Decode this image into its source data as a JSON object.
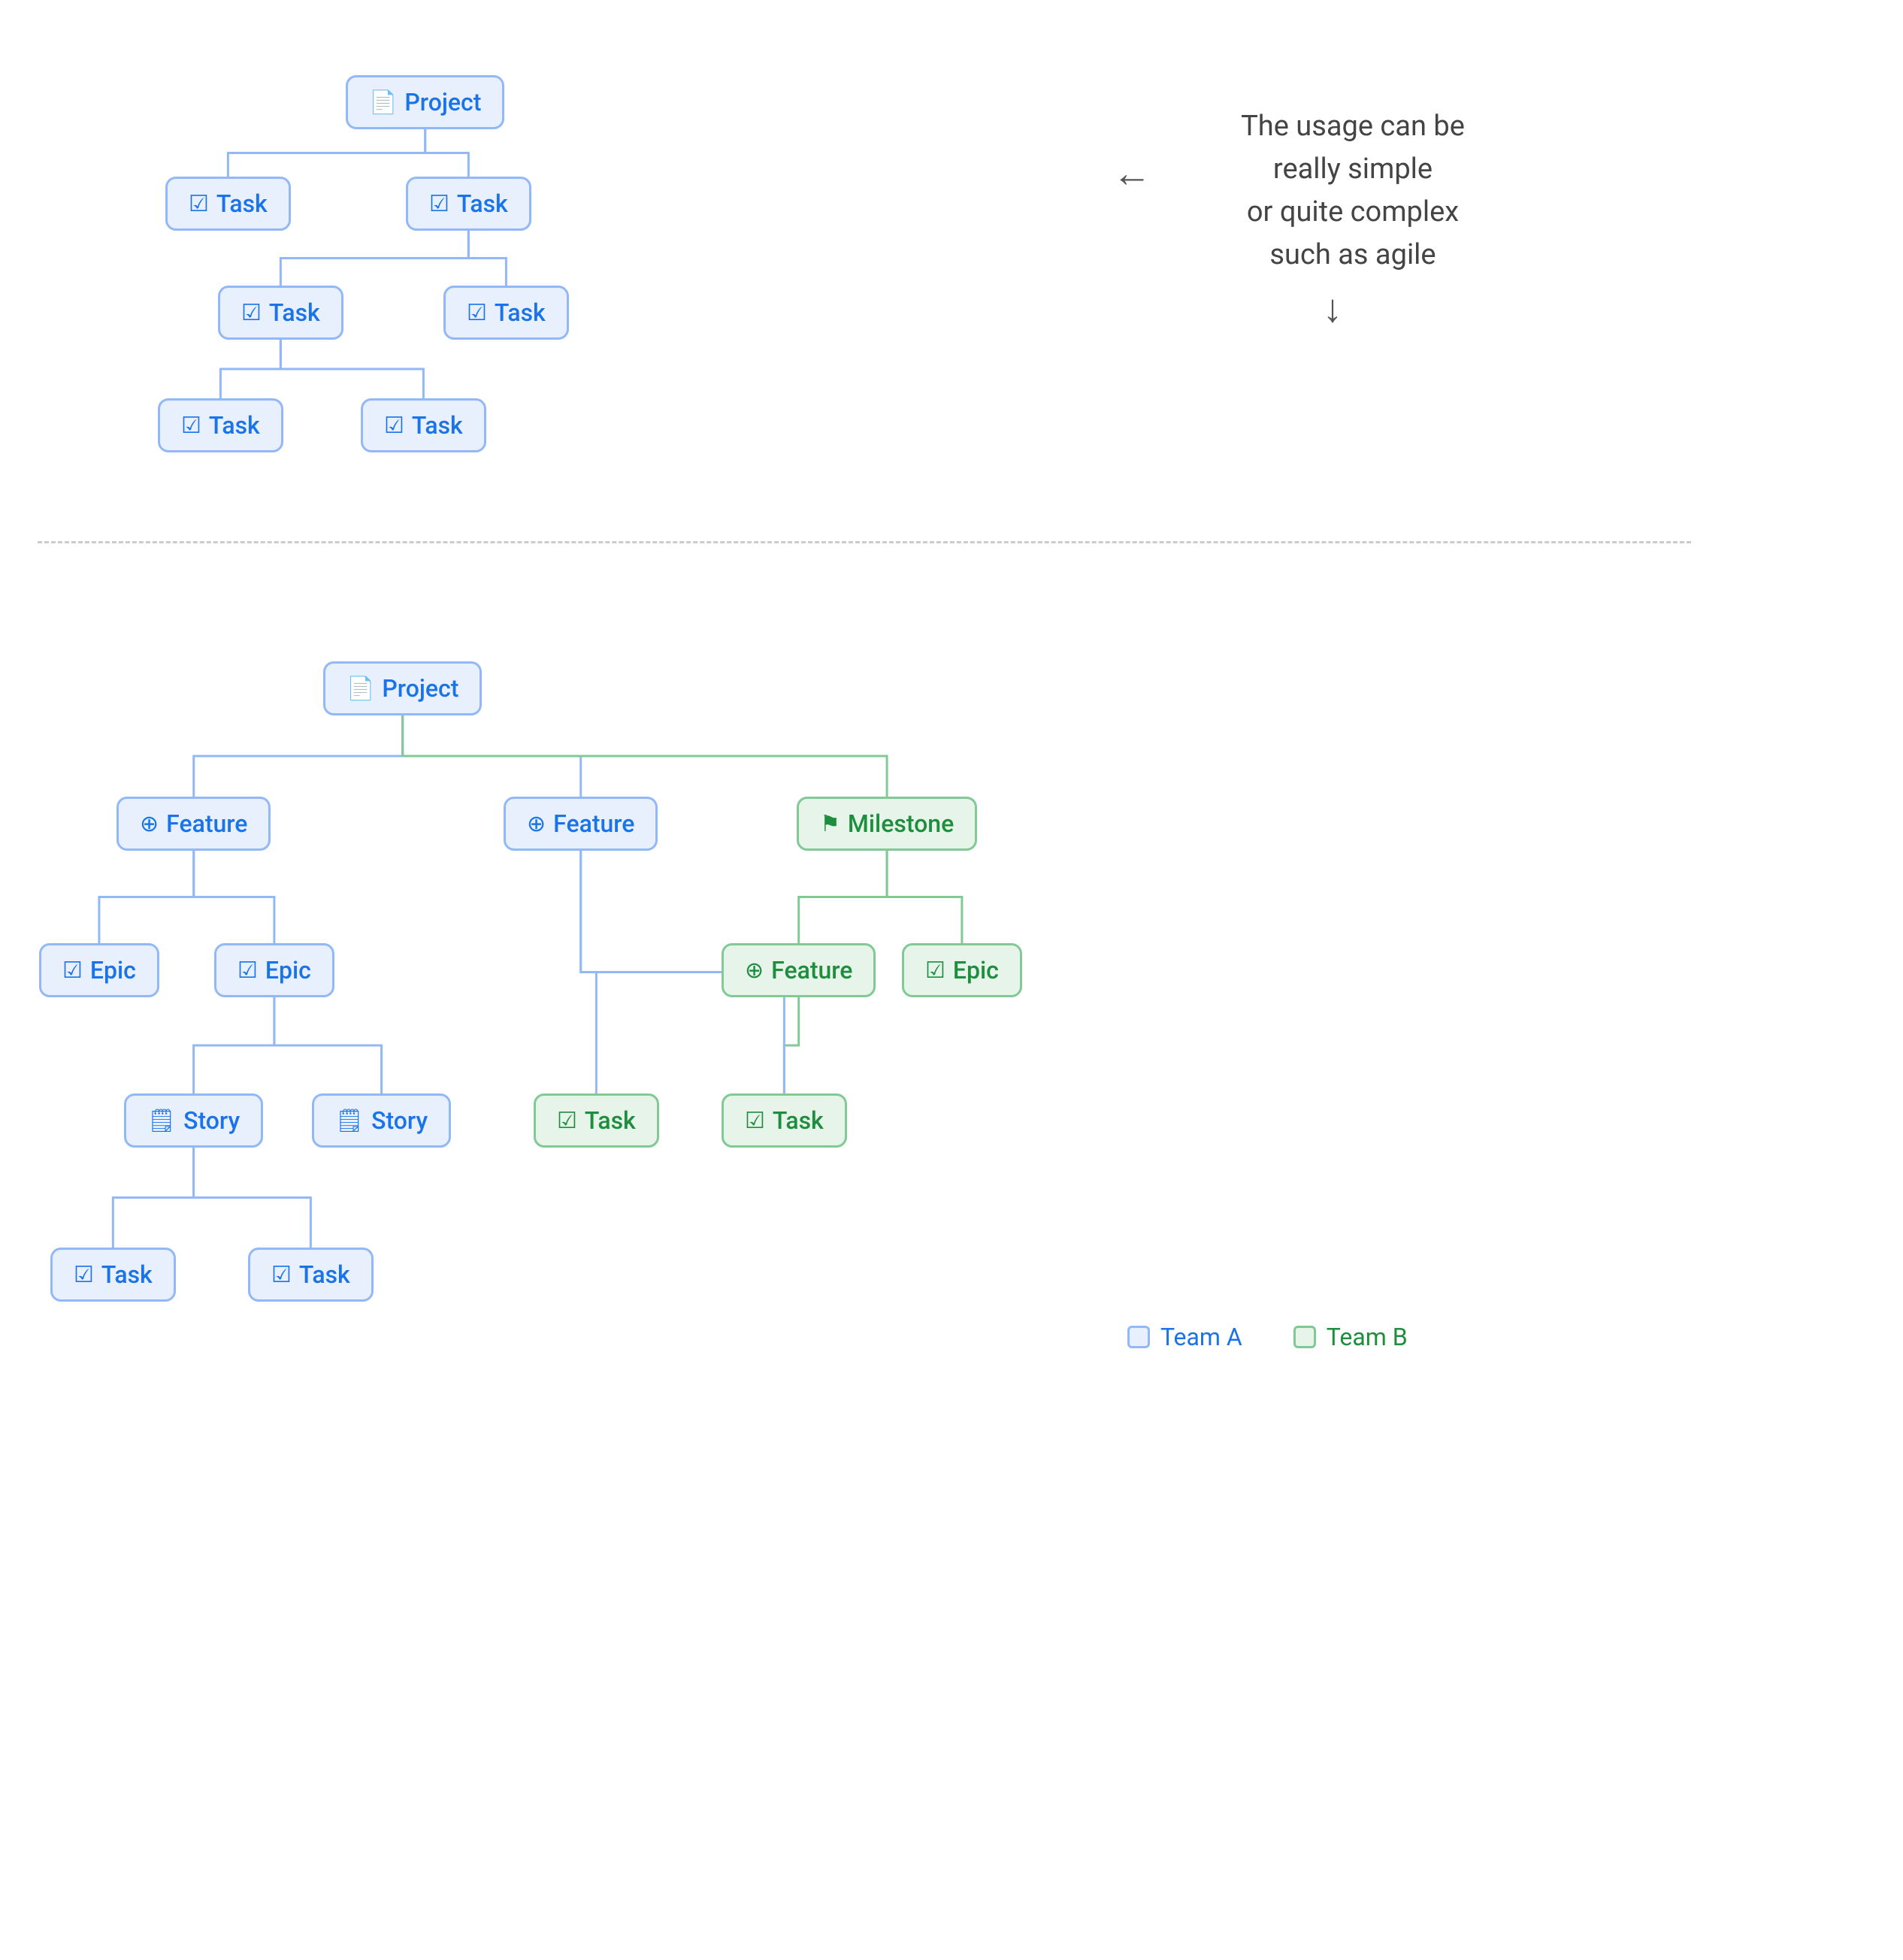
{
  "section1": {
    "project": {
      "label": "Project",
      "icon": "📄"
    },
    "task1": {
      "label": "Task",
      "icon": "☑"
    },
    "task2": {
      "label": "Task",
      "icon": "☑"
    },
    "task3": {
      "label": "Task",
      "icon": "☑"
    },
    "task4": {
      "label": "Task",
      "icon": "☑"
    },
    "task5": {
      "label": "Task",
      "icon": "☑"
    },
    "task6": {
      "label": "Task",
      "icon": "☑"
    }
  },
  "annotation": {
    "line1": "The usage can be",
    "line2": "really simple",
    "line3": "or quite complex",
    "line4": "such as agile"
  },
  "section2": {
    "project": {
      "label": "Project",
      "icon": "📄"
    },
    "feature1": {
      "label": "Feature",
      "icon": "⊕"
    },
    "feature2": {
      "label": "Feature",
      "icon": "⊕"
    },
    "milestone": {
      "label": "Milestone",
      "icon": "⚑"
    },
    "epic1": {
      "label": "Epic",
      "icon": "☑"
    },
    "epic2": {
      "label": "Epic",
      "icon": "☑"
    },
    "epic3": {
      "label": "Epic",
      "icon": "☑"
    },
    "story1": {
      "label": "Story",
      "icon": "🗒"
    },
    "story2": {
      "label": "Story",
      "icon": "🗒"
    },
    "task1": {
      "label": "Task",
      "icon": "☑"
    },
    "task2": {
      "label": "Task",
      "icon": "☑"
    },
    "task3": {
      "label": "Task",
      "icon": "☑"
    },
    "task4": {
      "label": "Task",
      "icon": "☑"
    },
    "feature3": {
      "label": "Feature",
      "icon": "⊕"
    }
  },
  "legend": {
    "teamA": "Team A",
    "teamB": "Team B"
  }
}
